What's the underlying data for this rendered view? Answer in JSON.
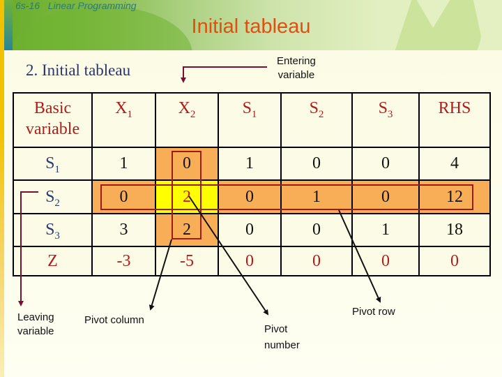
{
  "slide": {
    "subtitle": "6s-16   Linear Programming",
    "title": "Initial tableau",
    "section_heading": "2. Initial tableau"
  },
  "colors": {
    "title": "#de4f10",
    "header_text": "#b01c1c",
    "row_label_text": "#2a3a7a",
    "pivot_highlight": "#f8ae57",
    "pivot_number_highlight": "#ffff00",
    "box_outline": "#a01818",
    "entering_arrow": "#7a1030"
  },
  "tableau": {
    "headers": [
      {
        "main": "Basic variable",
        "sub": ""
      },
      {
        "main": "X",
        "sub": "1"
      },
      {
        "main": "X",
        "sub": "2"
      },
      {
        "main": "S",
        "sub": "1"
      },
      {
        "main": "S",
        "sub": "2"
      },
      {
        "main": "S",
        "sub": "3"
      },
      {
        "main": "RHS",
        "sub": ""
      }
    ],
    "basic_header_line1": "Basic",
    "basic_header_line2": "variable",
    "rows": [
      {
        "label": "S",
        "sub": "1",
        "values": [
          "1",
          "0",
          "1",
          "0",
          "0",
          "4"
        ]
      },
      {
        "label": "S",
        "sub": "2",
        "values": [
          "0",
          "2",
          "0",
          "1",
          "0",
          "12"
        ]
      },
      {
        "label": "S",
        "sub": "3",
        "values": [
          "3",
          "2",
          "0",
          "0",
          "1",
          "18"
        ]
      },
      {
        "label": "Z",
        "sub": "",
        "values": [
          "-3",
          "-5",
          "0",
          "0",
          "0",
          "0"
        ]
      }
    ],
    "pivot_column": "X2",
    "pivot_row": "S2",
    "pivot_number": "2"
  },
  "annotations": {
    "entering_line1": "Entering",
    "entering_line2": "variable",
    "leaving_line1": "Leaving",
    "leaving_line2": "variable",
    "pivot_column": "Pivot column",
    "pivot_number_line1": "Pivot",
    "pivot_number_line2": "number",
    "pivot_row": "Pivot row"
  }
}
